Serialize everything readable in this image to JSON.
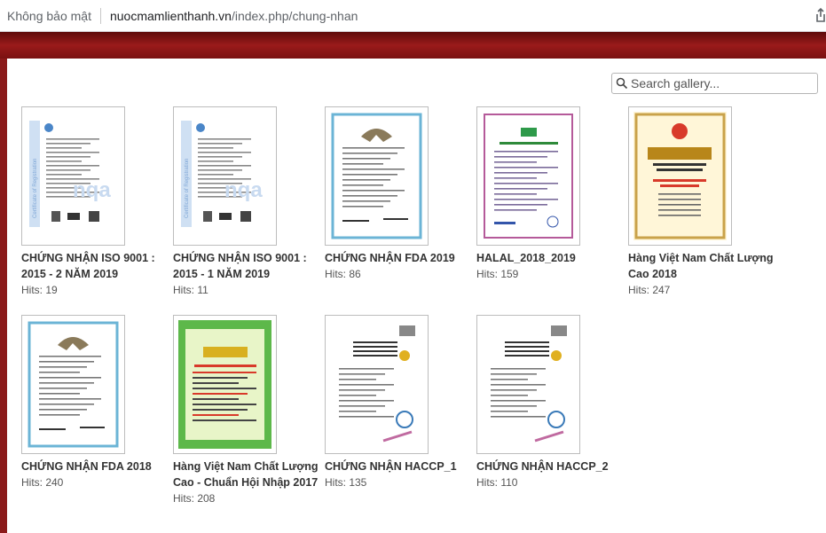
{
  "browser": {
    "security_label": "Không bảo mật",
    "url_host": "nuocmamlienthanh.vn",
    "url_path": "/index.php/chung-nhan"
  },
  "search": {
    "placeholder": "Search gallery..."
  },
  "gallery": {
    "items": [
      {
        "title": "CHỨNG NHẬN ISO 9001 : 2015 - 2 NĂM 2019",
        "hits": "Hits: 19",
        "thumb": "iso"
      },
      {
        "title": "CHỨNG NHẬN ISO 9001 : 2015 - 1 NĂM 2019",
        "hits": "Hits: 11",
        "thumb": "iso"
      },
      {
        "title": "CHỨNG NHẬN FDA 2019",
        "hits": "Hits: 86",
        "thumb": "fda"
      },
      {
        "title": "HALAL_2018_2019",
        "hits": "Hits: 159",
        "thumb": "halal"
      },
      {
        "title": "Hàng Việt Nam Chất Lượng Cao 2018",
        "hits": "Hits: 247",
        "thumb": "hvnclc"
      },
      {
        "title": "CHỨNG NHẬN FDA 2018",
        "hits": "Hits: 240",
        "thumb": "fda"
      },
      {
        "title": "Hàng Việt Nam Chất Lượng Cao - Chuẩn Hội Nhập 2017",
        "hits": "Hits: 208",
        "thumb": "green"
      },
      {
        "title": "CHỨNG NHẬN HACCP_1",
        "hits": "Hits: 135",
        "thumb": "haccp"
      },
      {
        "title": "CHỨNG NHẬN HACCP_2",
        "hits": "Hits: 110",
        "thumb": "haccp"
      }
    ]
  },
  "colors": {
    "header": "#8b1a1a",
    "text": "#333333"
  }
}
